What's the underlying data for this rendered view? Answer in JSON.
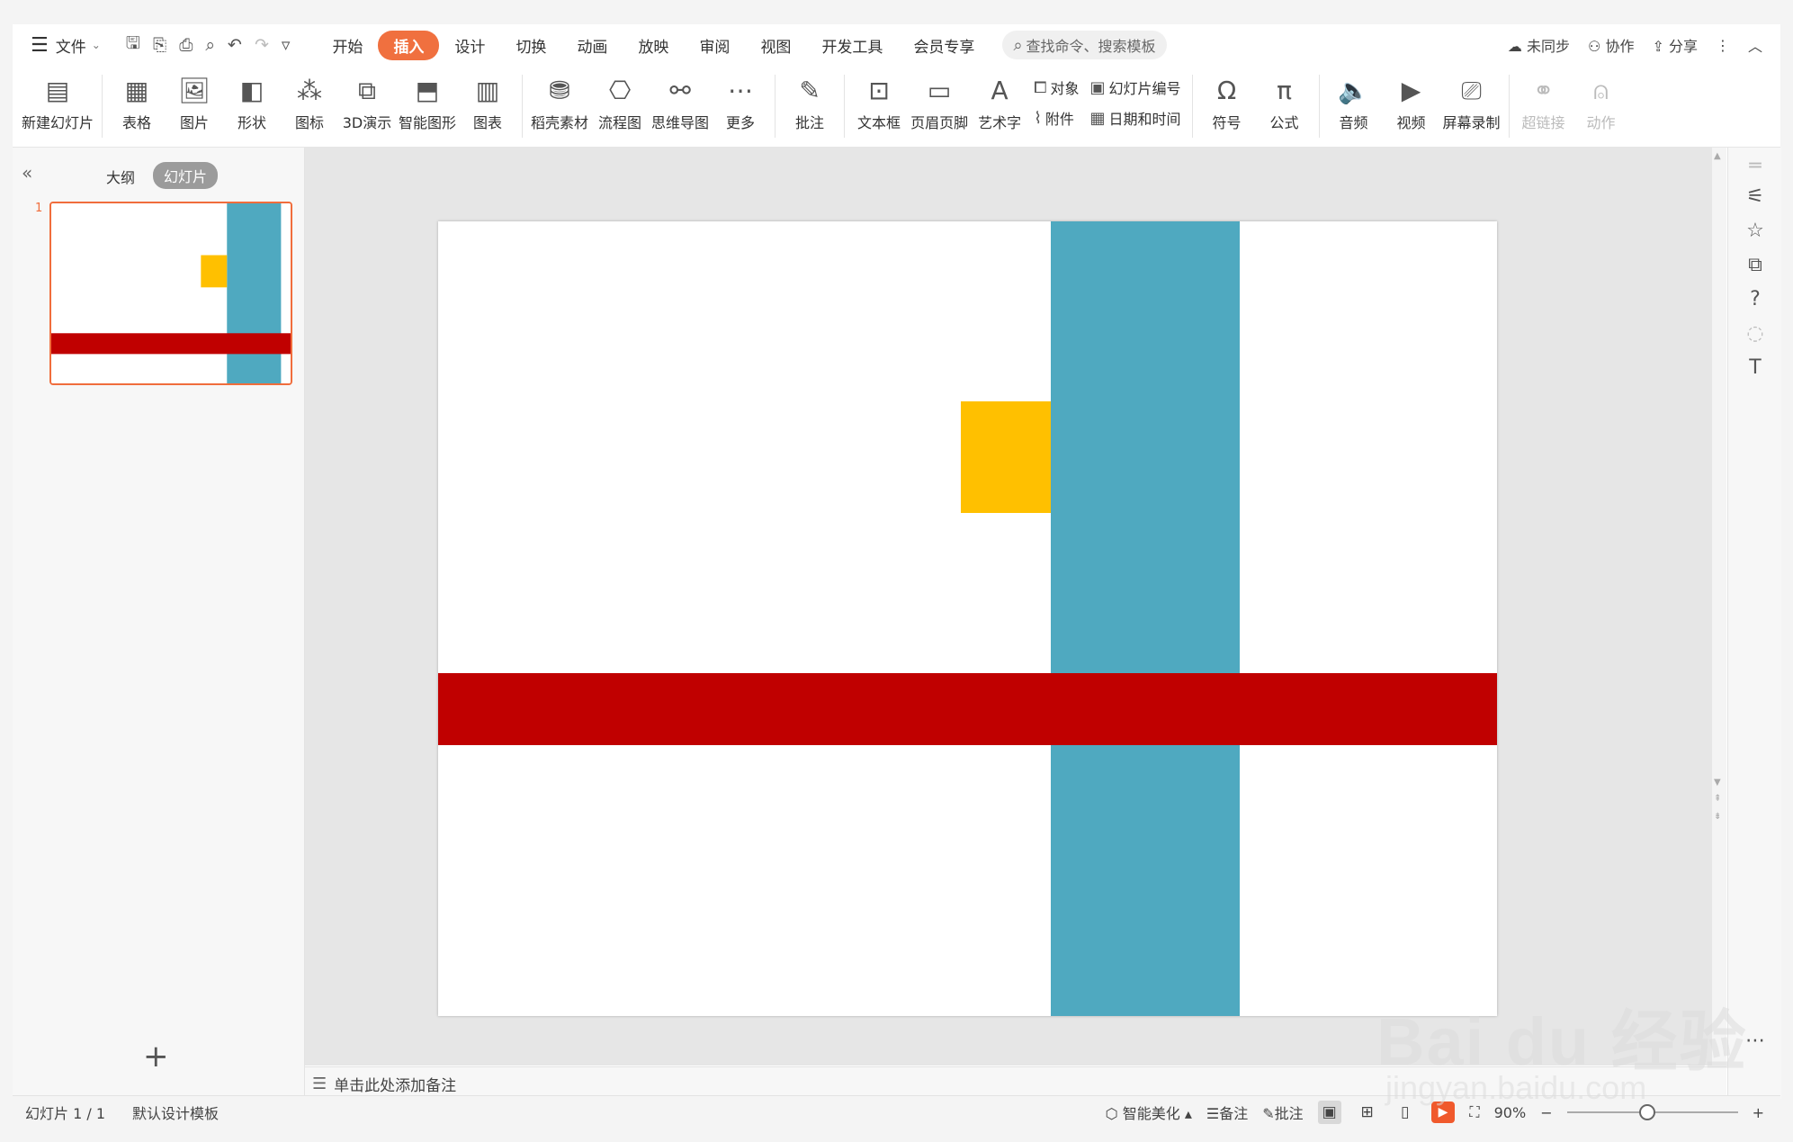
{
  "menubar": {
    "file_label": "文件",
    "tabs": [
      "开始",
      "插入",
      "设计",
      "切换",
      "动画",
      "放映",
      "审阅",
      "视图",
      "开发工具",
      "会员专享"
    ],
    "search_placeholder": "查找命令、搜索模板",
    "right": [
      "未同步",
      "协作",
      "分享"
    ]
  },
  "ribbon": {
    "new_slide": "新建幻灯片",
    "table": "表格",
    "picture": "图片",
    "shape": "形状",
    "icon": "图标",
    "demo3d": "3D演示",
    "smartart": "智能图形",
    "chart": "图表",
    "docer": "稻壳素材",
    "flowchart": "流程图",
    "mindmap": "思维导图",
    "more": "更多",
    "comment": "批注",
    "textbox": "文本框",
    "headerfooter": "页眉页脚",
    "wordart": "艺术字",
    "object": "对象",
    "attachment": "附件",
    "slidenum": "幻灯片编号",
    "datetime": "日期和时间",
    "symbol": "符号",
    "formula": "公式",
    "audio": "音频",
    "video": "视频",
    "screenrec": "屏幕录制",
    "hyperlink": "超链接",
    "action": "动作"
  },
  "leftpanel": {
    "tab_outline": "大纲",
    "tab_slides": "幻灯片",
    "slide_number": "1"
  },
  "slide": {
    "shapes": [
      {
        "name": "teal-vertical-bar",
        "color": "#4fa9c0"
      },
      {
        "name": "yellow-square",
        "color": "#ffc000"
      },
      {
        "name": "red-horizontal-band",
        "color": "#c00000"
      }
    ]
  },
  "notes": {
    "placeholder": "单击此处添加备注"
  },
  "status": {
    "slide_info": "幻灯片 1 / 1",
    "template": "默认设计模板",
    "beautify": "智能美化",
    "notes": "备注",
    "comments": "批注",
    "zoom": "90%"
  },
  "watermark": {
    "main": "Bai du 经验",
    "sub": "jingyan.baidu.com"
  }
}
